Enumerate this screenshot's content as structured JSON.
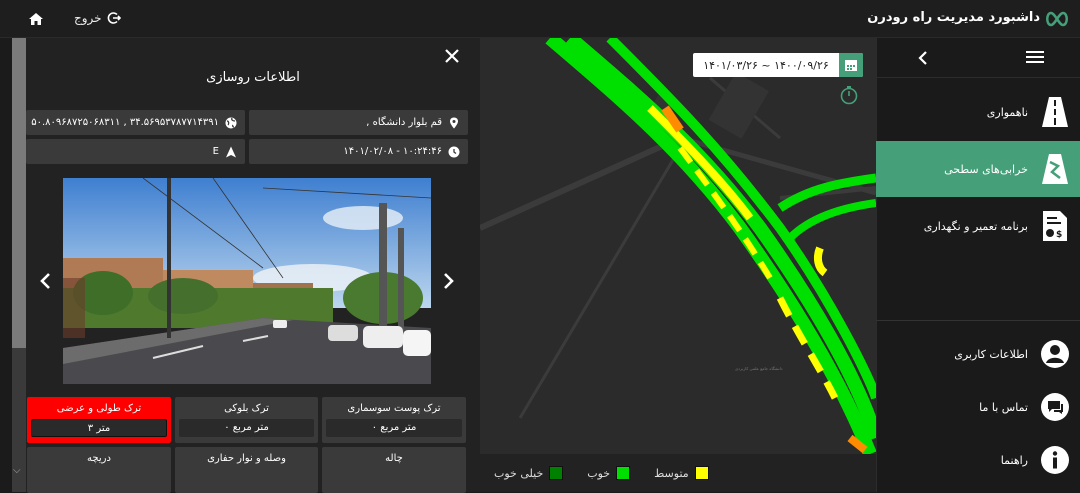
{
  "header": {
    "title": "داشبورد مدیریت راه رودرن",
    "logout_label": "خروج"
  },
  "sidebar": {
    "items": [
      {
        "label": "ناهمواری",
        "icon": "road-icon",
        "active": false
      },
      {
        "label": "خرابی‌های سطحی",
        "icon": "road-damage-icon",
        "active": true
      },
      {
        "label": "برنامه تعمیر و نگهداری",
        "icon": "maintenance-invoice-icon",
        "active": false
      },
      {
        "label": "اطلاعات کاربری",
        "icon": "user-icon",
        "active": false
      },
      {
        "label": "تماس با ما",
        "icon": "chat-icon",
        "active": false
      },
      {
        "label": "راهنما",
        "icon": "info-icon",
        "active": false
      }
    ]
  },
  "map": {
    "date_range": "۱۴۰۱/۰۳/۲۶ ~ ۱۴۰۰/۰۹/۲۶",
    "place_label": "دانشگاه جامع علمی کاربردی",
    "legend": [
      {
        "label": "خیلی خوب",
        "color": "#008000"
      },
      {
        "label": "خوب",
        "color": "#00e000"
      },
      {
        "label": "متوسط",
        "color": "#ffff00"
      }
    ]
  },
  "panel": {
    "title": "اطلاعات روسازی",
    "coordinates": "۵۰.۸۰۹۶۸۷۲۵۰۶۸۳۱۱ , ۳۴.۵۶۹۵۳۷۸۷۷۱۴۳۹۱",
    "address": ", قم بلوار دانشگاه",
    "heading": "E",
    "datetime": "۱۴۰۱/۰۲/۰۸ - ۱۰:۲۴:۴۶",
    "defects": [
      {
        "label": "ترک پوست سوسماری",
        "value": "۰ متر مربع",
        "highlight": false
      },
      {
        "label": "ترک بلوکی",
        "value": "۰ متر مربع",
        "highlight": false
      },
      {
        "label": "ترک طولی و عرضی",
        "value": "۳ متر",
        "highlight": true
      },
      {
        "label": "چاله",
        "value": "",
        "highlight": false
      },
      {
        "label": "وصله و نوار حفاری",
        "value": "",
        "highlight": false
      },
      {
        "label": "دریچه",
        "value": "",
        "highlight": false
      }
    ]
  },
  "colors": {
    "accent": "#45a07a",
    "highlight_red": "#ff0000",
    "very_good": "#008000",
    "good": "#00e000",
    "medium": "#ffff00",
    "poor": "#ff8c00"
  }
}
